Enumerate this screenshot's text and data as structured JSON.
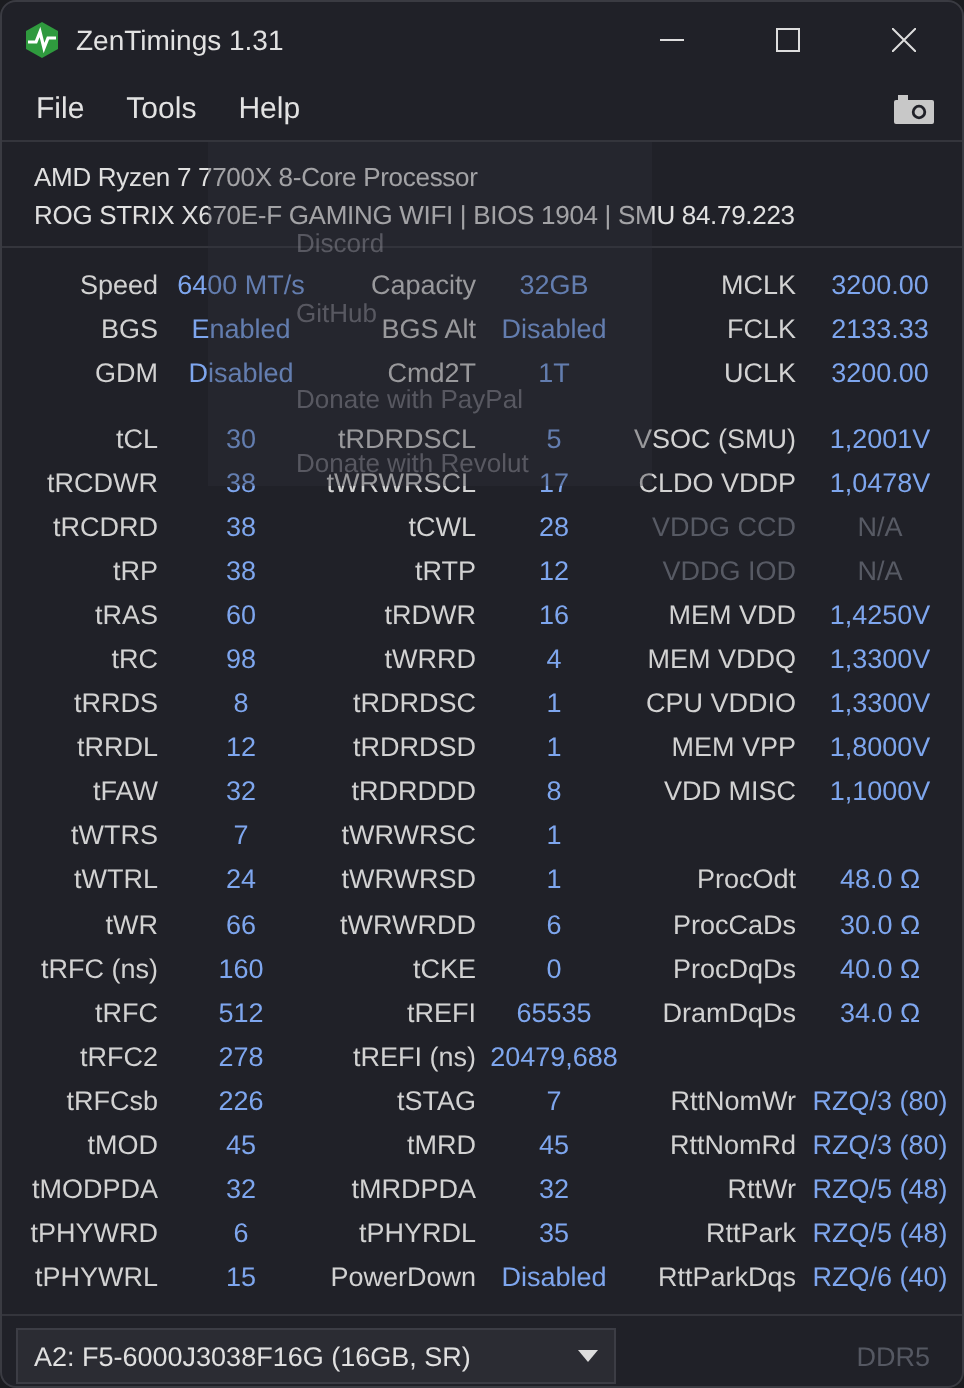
{
  "window": {
    "title": "ZenTimings 1.31"
  },
  "menu": [
    "File",
    "Tools",
    "Help"
  ],
  "help_menu": [
    "Discord",
    "GitHub",
    "Donate with PayPal",
    "Donate with Revolut"
  ],
  "processor": {
    "name": "AMD Ryzen 7 7700X 8-Core Processor",
    "board": "ROG STRIX X670E-F GAMING WIFI | BIOS 1904 | SMU 84.79.223"
  },
  "info_rows": [
    [
      {
        "label": "Speed",
        "value": "6400 MT/s"
      },
      {
        "label": "Capacity",
        "value": "32GB"
      },
      {
        "label": "MCLK",
        "value": "3200.00"
      }
    ],
    [
      {
        "label": "BGS",
        "value": "Enabled"
      },
      {
        "label": "BGS Alt",
        "value": "Disabled"
      },
      {
        "label": "FCLK",
        "value": "2133.33"
      }
    ],
    [
      {
        "label": "GDM",
        "value": "Disabled"
      },
      {
        "label": "Cmd2T",
        "value": "1T"
      },
      {
        "label": "UCLK",
        "value": "3200.00"
      }
    ]
  ],
  "timings_column_1": [
    {
      "label": "tCL",
      "value": "30"
    },
    {
      "label": "tRCDWR",
      "value": "38"
    },
    {
      "label": "tRCDRD",
      "value": "38"
    },
    {
      "label": "tRP",
      "value": "38"
    },
    {
      "label": "tRAS",
      "value": "60"
    },
    {
      "label": "tRC",
      "value": "98"
    },
    {
      "label": "tRRDS",
      "value": "8"
    },
    {
      "label": "tRRDL",
      "value": "12"
    },
    {
      "label": "tFAW",
      "value": "32"
    },
    {
      "label": "tWTRS",
      "value": "7"
    },
    {
      "label": "tWTRL",
      "value": "24"
    },
    {
      "label": "tWR",
      "value": "66"
    },
    {
      "label": "tRFC (ns)",
      "value": "160"
    },
    {
      "label": "tRFC",
      "value": "512"
    },
    {
      "label": "tRFC2",
      "value": "278"
    },
    {
      "label": "tRFCsb",
      "value": "226"
    },
    {
      "label": "tMOD",
      "value": "45"
    },
    {
      "label": "tMODPDA",
      "value": "32"
    },
    {
      "label": "tPHYWRD",
      "value": "6"
    },
    {
      "label": "tPHYWRL",
      "value": "15"
    }
  ],
  "timings_column_2": [
    {
      "label": "tRDRDSCL",
      "value": "5"
    },
    {
      "label": "tWRWRSCL",
      "value": "17"
    },
    {
      "label": "tCWL",
      "value": "28"
    },
    {
      "label": "tRTP",
      "value": "12"
    },
    {
      "label": "tRDWR",
      "value": "16"
    },
    {
      "label": "tWRRD",
      "value": "4"
    },
    {
      "label": "tRDRDSC",
      "value": "1"
    },
    {
      "label": "tRDRDSD",
      "value": "1"
    },
    {
      "label": "tRDRDDD",
      "value": "8"
    },
    {
      "label": "tWRWRSC",
      "value": "1"
    },
    {
      "label": "tWRWRSD",
      "value": "1"
    },
    {
      "label": "tWRWRDD",
      "value": "6"
    },
    {
      "label": "tCKE",
      "value": "0"
    },
    {
      "label": "tREFI",
      "value": "65535"
    },
    {
      "label": "tREFI (ns)",
      "value": "20479,688"
    },
    {
      "label": "tSTAG",
      "value": "7"
    },
    {
      "label": "tMRD",
      "value": "45"
    },
    {
      "label": "tMRDPDA",
      "value": "32"
    },
    {
      "label": "tPHYRDL",
      "value": "35"
    },
    {
      "label": "PowerDown",
      "value": "Disabled"
    }
  ],
  "timings_column_3_groups": [
    [
      {
        "label": "VSOC (SMU)",
        "value": "1,2001V",
        "disabled": false
      },
      {
        "label": "CLDO VDDP",
        "value": "1,0478V",
        "disabled": false
      },
      {
        "label": "VDDG CCD",
        "value": "N/A",
        "disabled": true
      },
      {
        "label": "VDDG IOD",
        "value": "N/A",
        "disabled": true
      },
      {
        "label": "MEM VDD",
        "value": "1,4250V",
        "disabled": false
      },
      {
        "label": "MEM VDDQ",
        "value": "1,3300V",
        "disabled": false
      },
      {
        "label": "CPU VDDIO",
        "value": "1,3300V",
        "disabled": false
      },
      {
        "label": "MEM VPP",
        "value": "1,8000V",
        "disabled": false
      },
      {
        "label": "VDD MISC",
        "value": "1,1000V",
        "disabled": false
      }
    ],
    [
      {
        "label": "ProcOdt",
        "value": "48.0 Ω",
        "disabled": false
      },
      {
        "label": "ProcCaDs",
        "value": "30.0 Ω",
        "disabled": false
      },
      {
        "label": "ProcDqDs",
        "value": "40.0 Ω",
        "disabled": false
      },
      {
        "label": "DramDqDs",
        "value": "34.0 Ω",
        "disabled": false
      }
    ],
    [
      {
        "label": "RttNomWr",
        "value": "RZQ/3 (80)",
        "disabled": false
      },
      {
        "label": "RttNomRd",
        "value": "RZQ/3 (80)",
        "disabled": false
      },
      {
        "label": "RttWr",
        "value": "RZQ/5 (48)",
        "disabled": false
      },
      {
        "label": "RttPark",
        "value": "RZQ/5 (48)",
        "disabled": false
      },
      {
        "label": "RttParkDqs",
        "value": "RZQ/6 (40)",
        "disabled": false
      }
    ]
  ],
  "module_select": {
    "value": "A2: F5-6000J3038F16G (16GB, SR)"
  },
  "memory_type": "DDR5"
}
